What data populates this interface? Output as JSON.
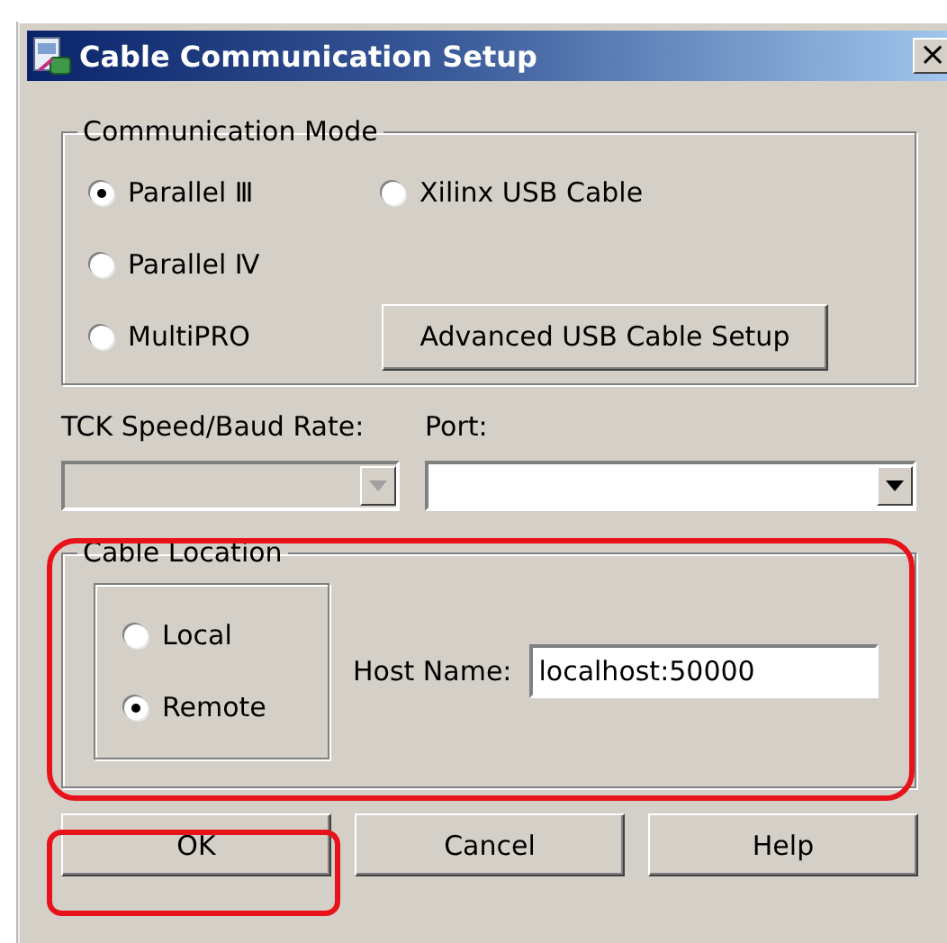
{
  "window": {
    "title": "Cable Communication Setup",
    "close": "×"
  },
  "communication_mode": {
    "title": "Communication Mode",
    "options": [
      {
        "label": "Parallel Ⅲ",
        "selected": true
      },
      {
        "label": "Parallel Ⅳ",
        "selected": false
      },
      {
        "label": "MultiPRO",
        "selected": false
      },
      {
        "label": "Xilinx USB Cable",
        "selected": false
      }
    ],
    "advanced_button": "Advanced USB Cable Setup"
  },
  "speed": {
    "label": "TCK Speed/Baud Rate:",
    "disabled": true
  },
  "port": {
    "label": "Port:",
    "disabled": false
  },
  "cable_location": {
    "title": "Cable Location",
    "options": [
      {
        "label": "Local",
        "selected": false
      },
      {
        "label": "Remote",
        "selected": true
      }
    ],
    "host_label": "Host Name:",
    "host_value": "localhost:50000"
  },
  "buttons": [
    "OK",
    "Cancel",
    "Help"
  ]
}
